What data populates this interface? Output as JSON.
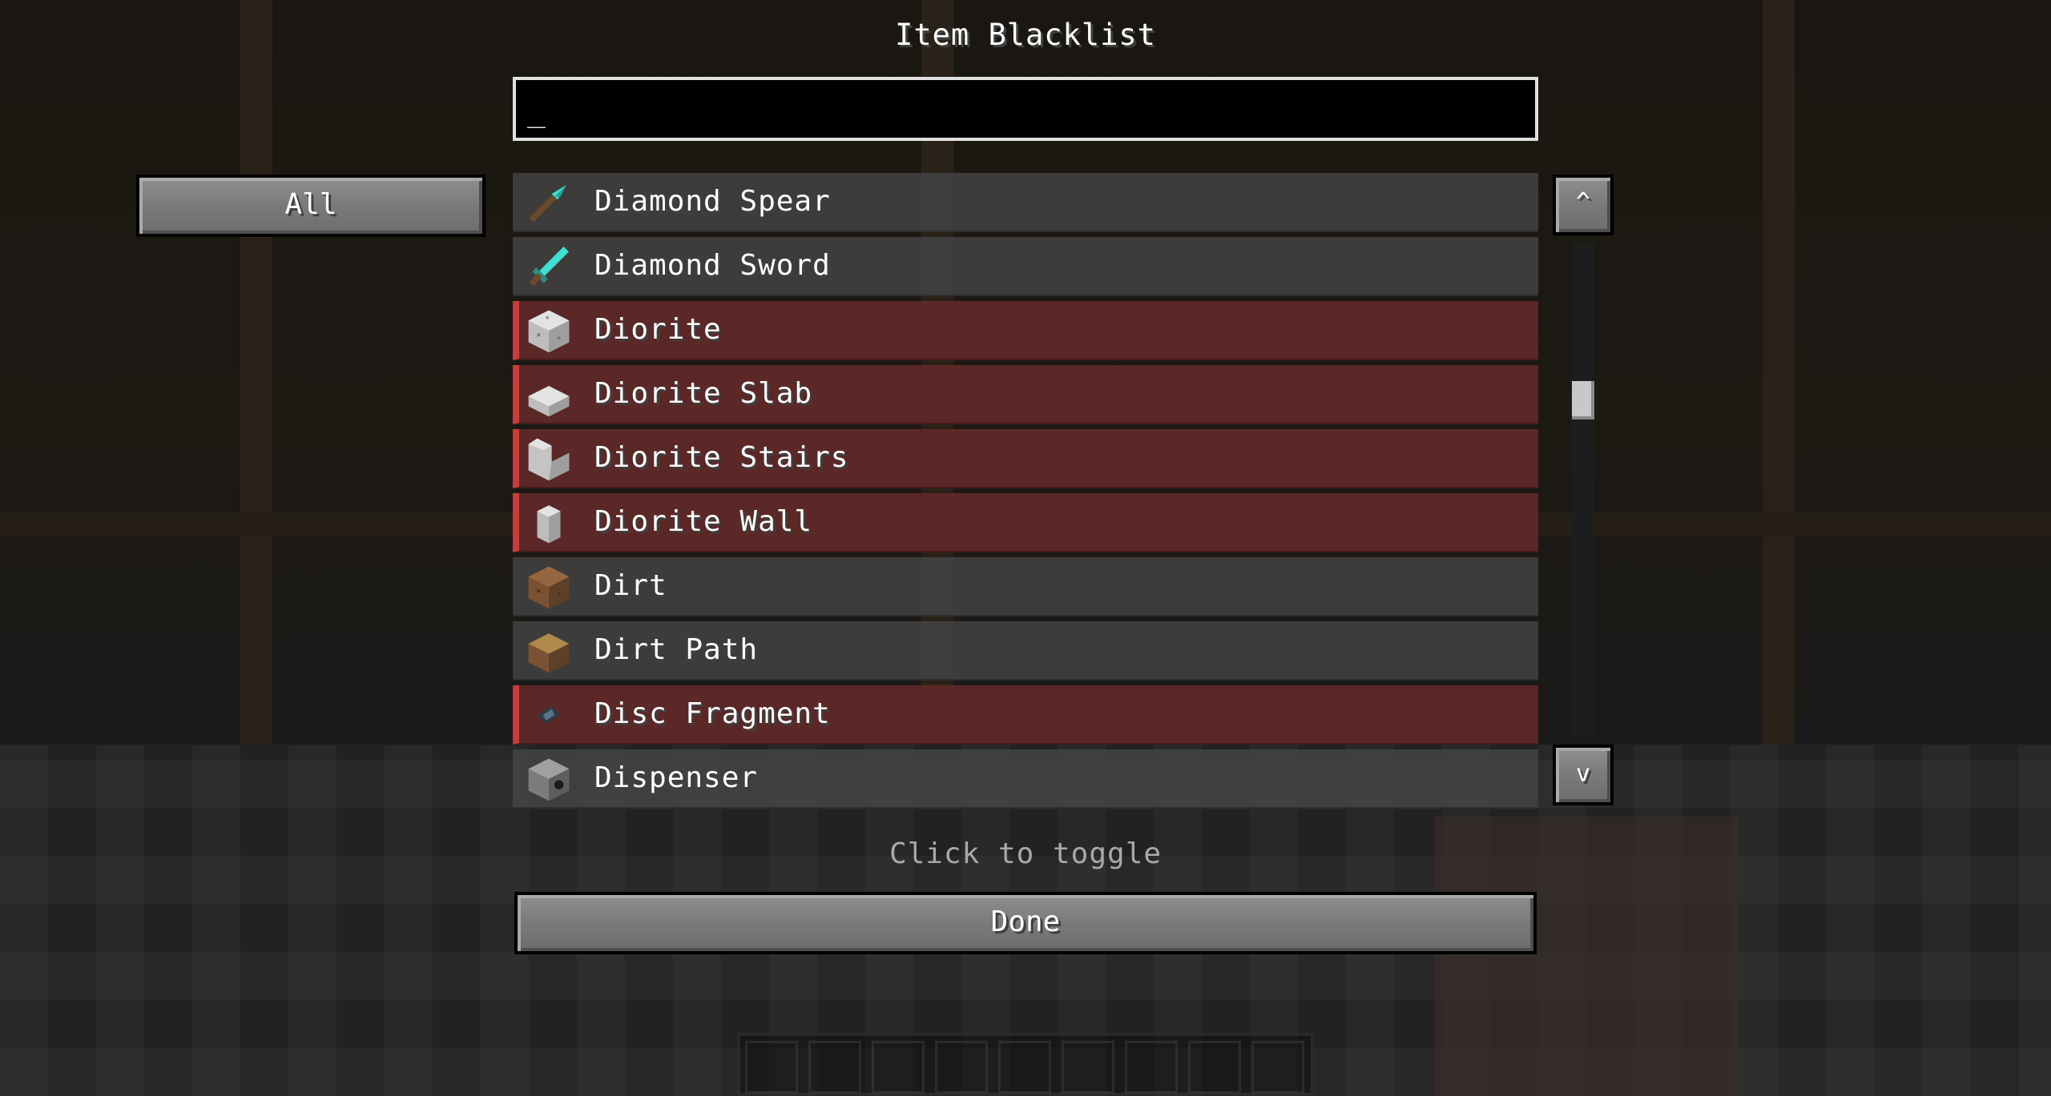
{
  "screen": {
    "title": "Item Blacklist"
  },
  "search": {
    "value": "_"
  },
  "filter_button": {
    "label": "All"
  },
  "scroll_up": {
    "label": "^"
  },
  "scroll_down": {
    "label": "v"
  },
  "items": [
    {
      "label": "Diamond Spear",
      "blacklisted": false,
      "icon": "diamond-spear-icon"
    },
    {
      "label": "Diamond Sword",
      "blacklisted": false,
      "icon": "diamond-sword-icon"
    },
    {
      "label": "Diorite",
      "blacklisted": true,
      "icon": "diorite-icon"
    },
    {
      "label": "Diorite Slab",
      "blacklisted": true,
      "icon": "diorite-slab-icon"
    },
    {
      "label": "Diorite Stairs",
      "blacklisted": true,
      "icon": "diorite-stairs-icon"
    },
    {
      "label": "Diorite Wall",
      "blacklisted": true,
      "icon": "diorite-wall-icon"
    },
    {
      "label": "Dirt",
      "blacklisted": false,
      "icon": "dirt-icon"
    },
    {
      "label": "Dirt Path",
      "blacklisted": false,
      "icon": "dirt-path-icon"
    },
    {
      "label": "Disc Fragment",
      "blacklisted": true,
      "icon": "disc-fragment-icon"
    },
    {
      "label": "Dispenser",
      "blacklisted": false,
      "icon": "dispenser-icon"
    }
  ],
  "hint": "Click to toggle",
  "done_button": {
    "label": "Done"
  },
  "colors": {
    "blacklisted_row": "#5b2727",
    "blacklisted_marker": "#c93c3c",
    "normal_row": "#464646"
  }
}
